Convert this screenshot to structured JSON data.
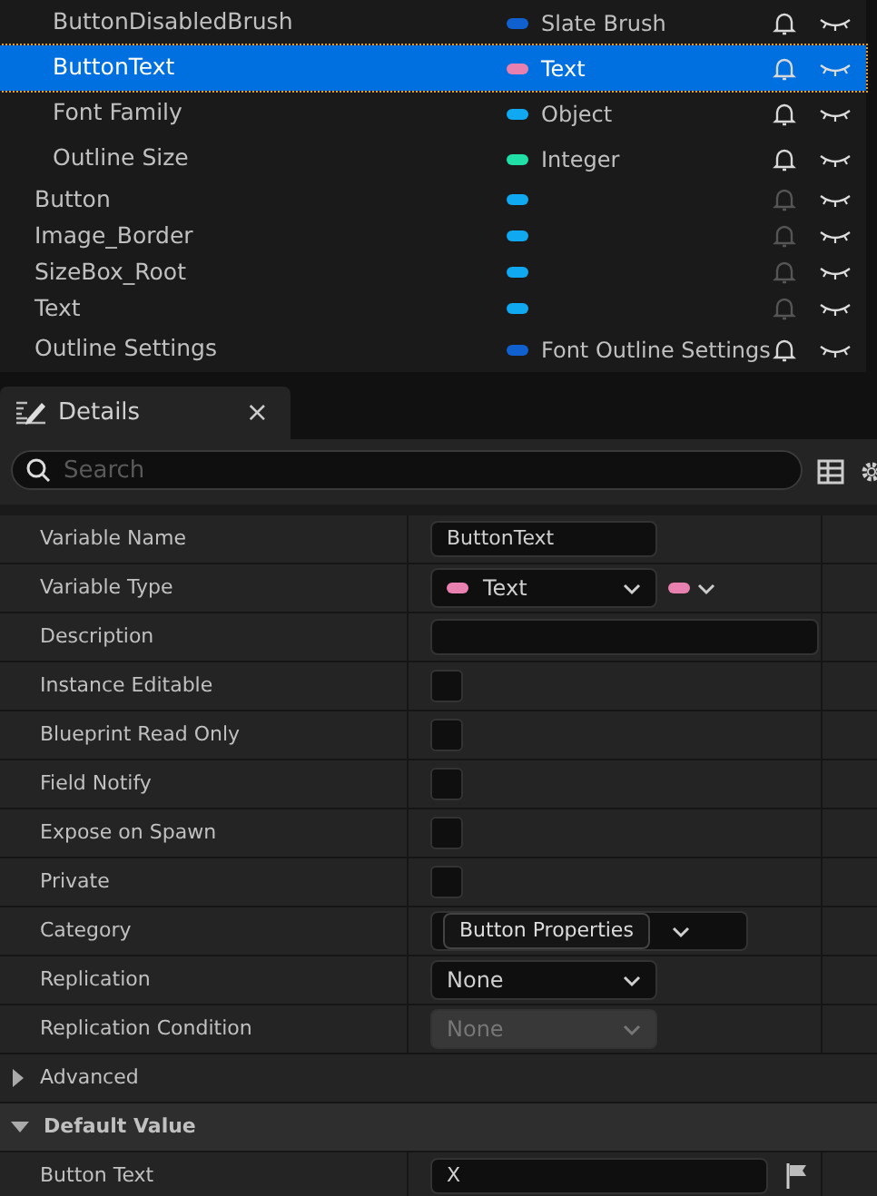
{
  "variables": [
    {
      "name": "ButtonDisabledBrush",
      "type": "Slate Brush",
      "color": "#1060d0",
      "indented": true,
      "selected": false,
      "notify": true
    },
    {
      "name": "ButtonText",
      "type": "Text",
      "color": "#e880b0",
      "indented": true,
      "selected": true,
      "notify": true
    },
    {
      "name": "Font Family",
      "type": "Object",
      "color": "#10a8f0",
      "indented": true,
      "selected": false,
      "notify": true
    },
    {
      "name": "Outline Size",
      "type": "Integer",
      "color": "#20e0a8",
      "indented": true,
      "selected": false,
      "notify": true
    },
    {
      "name": "Button",
      "color": "#10a8f0",
      "indented": false,
      "selected": false,
      "notify": false
    },
    {
      "name": "Image_Border",
      "color": "#10a8f0",
      "indented": false,
      "selected": false,
      "notify": false
    },
    {
      "name": "SizeBox_Root",
      "color": "#10a8f0",
      "indented": false,
      "selected": false,
      "notify": false
    },
    {
      "name": "Text",
      "color": "#10a8f0",
      "indented": false,
      "selected": false,
      "notify": false
    },
    {
      "name": "Outline Settings",
      "type": "Font Outline Settings",
      "color": "#1060d0",
      "indented": false,
      "selected": false,
      "notify": true
    }
  ],
  "details_tab": {
    "title": "Details",
    "close": "×"
  },
  "search": {
    "placeholder": "Search"
  },
  "properties": [
    {
      "label": "Variable Name",
      "kind": "text",
      "value": "ButtonText"
    },
    {
      "label": "Variable Type",
      "kind": "type",
      "value": "Text",
      "color": "#e880b0"
    },
    {
      "label": "Description",
      "kind": "wide-text"
    },
    {
      "label": "Instance Editable",
      "kind": "checkbox",
      "checked": false
    },
    {
      "label": "Blueprint Read Only",
      "kind": "checkbox",
      "checked": false
    },
    {
      "label": "Field Notify",
      "kind": "checkbox",
      "checked": false
    },
    {
      "label": "Expose on Spawn",
      "kind": "checkbox",
      "checked": false
    },
    {
      "label": "Private",
      "kind": "checkbox",
      "checked": false
    },
    {
      "label": "Category",
      "kind": "category",
      "value": "Button Properties"
    },
    {
      "label": "Replication",
      "kind": "combo",
      "value": "None",
      "disabled": false
    },
    {
      "label": "Replication Condition",
      "kind": "combo",
      "value": "None",
      "disabled": true
    }
  ],
  "sections": [
    {
      "title": "Advanced",
      "expanded": false
    },
    {
      "title": "Default Value",
      "expanded": true,
      "rows": [
        {
          "label": "Button Text",
          "value": "X"
        }
      ]
    }
  ]
}
